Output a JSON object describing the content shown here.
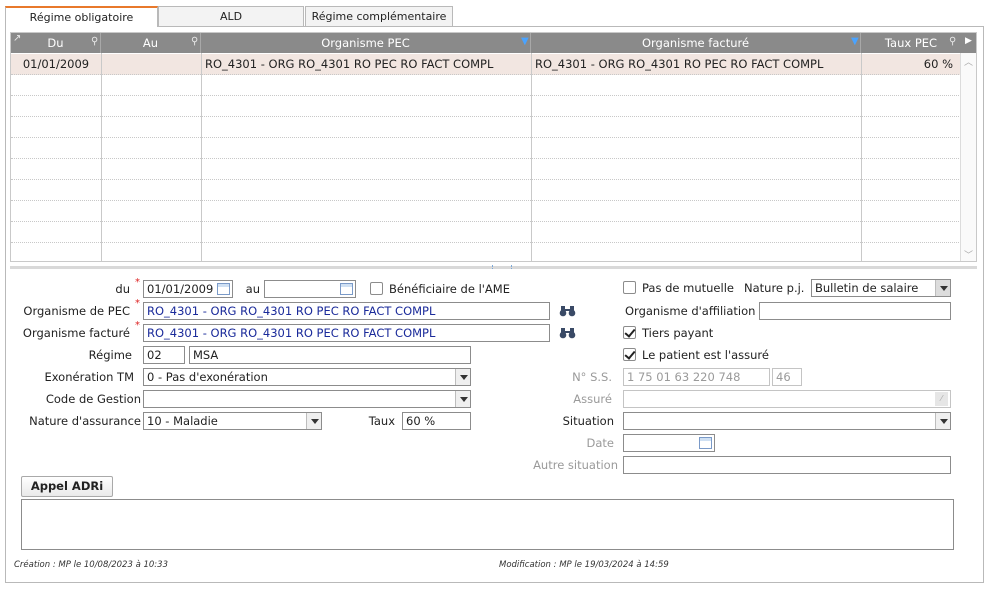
{
  "tabs": [
    {
      "label": "Régime obligatoire",
      "active": true
    },
    {
      "label": "ALD",
      "active": false
    },
    {
      "label": "Régime complémentaire",
      "active": false
    }
  ],
  "grid": {
    "columns": [
      "Du",
      "Au",
      "Organisme PEC",
      "Organisme facturé",
      "Taux PEC"
    ],
    "rows": [
      {
        "du": "01/01/2009",
        "au": "",
        "organisme_pec": "RO_4301 - ORG RO_4301 RO PEC RO FACT COMPL",
        "organisme_facture": "RO_4301 - ORG RO_4301 RO PEC RO FACT COMPL",
        "taux_pec": "60 %"
      }
    ]
  },
  "form": {
    "du_label": "du",
    "du_value": "01/01/2009",
    "au_label": "au",
    "au_value": "",
    "beneficiaire_ame_label": "Bénéficiaire de l'AME",
    "beneficiaire_ame_checked": false,
    "organisme_pec_label": "Organisme de PEC",
    "organisme_pec_value": "RO_4301 - ORG RO_4301 RO PEC RO FACT COMPL",
    "organisme_facture_label": "Organisme facturé",
    "organisme_facture_value": "RO_4301 - ORG RO_4301 RO PEC RO FACT COMPL",
    "regime_label": "Régime",
    "regime_code": "02",
    "regime_name": "MSA",
    "exoneration_label": "Exonération TM",
    "exoneration_value": "0 - Pas d'exonération",
    "code_gestion_label": "Code de Gestion",
    "code_gestion_value": "",
    "nature_assurance_label": "Nature d'assurance",
    "nature_assurance_value": "10 - Maladie",
    "taux_label": "Taux",
    "taux_value": "60 %",
    "pas_mutuelle_label": "Pas de mutuelle",
    "pas_mutuelle_checked": false,
    "nature_pj_label": "Nature p.j.",
    "nature_pj_value": "Bulletin de salaire",
    "organisme_affiliation_label": "Organisme d'affiliation",
    "organisme_affiliation_value": "",
    "tiers_payant_label": "Tiers payant",
    "tiers_payant_checked": true,
    "patient_assure_label": "Le patient est l'assuré",
    "patient_assure_checked": true,
    "nss_label": "N° S.S.",
    "nss_value": "1 75 01 63 220 748",
    "nss_key": "46",
    "assure_label": "Assuré",
    "assure_value": "",
    "situation_label": "Situation",
    "situation_value": "",
    "date_label": "Date",
    "date_value": "",
    "autre_situation_label": "Autre situation",
    "autre_situation_value": ""
  },
  "appel_adri_label": "Appel ADRi",
  "footer": {
    "creation": "Création : MP le 10/08/2023 à 10:33",
    "modification": "Modification : MP le 19/03/2024 à 14:59"
  },
  "colors": {
    "accent_tab": "#e8792b",
    "header_bg": "#8a8a8a",
    "selected_row": "#f2e6e1",
    "link_text": "#1a2a9a"
  }
}
